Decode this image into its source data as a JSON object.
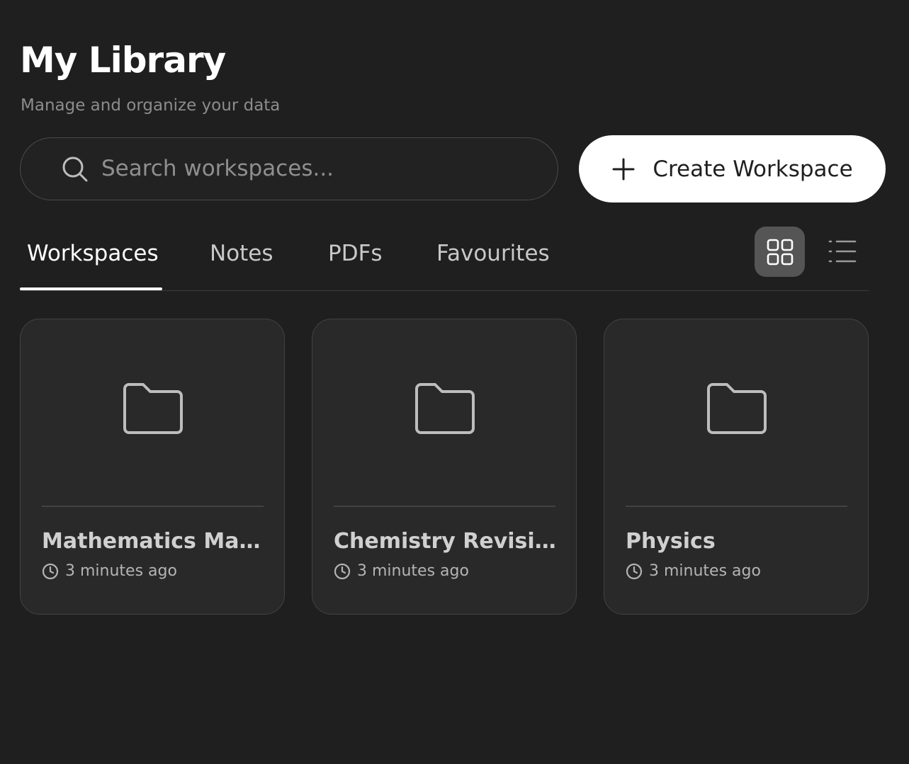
{
  "header": {
    "title": "My Library",
    "subtitle": "Manage and organize your data"
  },
  "search": {
    "placeholder": "Search workspaces...",
    "value": "",
    "icon": "search-icon"
  },
  "actions": {
    "create_label": "Create Workspace",
    "create_icon": "plus-icon"
  },
  "tabs": [
    {
      "label": "Workspaces",
      "active": true
    },
    {
      "label": "Notes",
      "active": false
    },
    {
      "label": "PDFs",
      "active": false
    },
    {
      "label": "Favourites",
      "active": false
    }
  ],
  "view_toggle": {
    "selected": "grid",
    "options": [
      "grid-icon",
      "list-icon"
    ]
  },
  "workspaces": [
    {
      "title": "Mathematics Mas…",
      "updated": "3 minutes ago",
      "icon": "folder-icon"
    },
    {
      "title": "Chemistry Revision",
      "updated": "3 minutes ago",
      "icon": "folder-icon"
    },
    {
      "title": "Physics",
      "updated": "3 minutes ago",
      "icon": "folder-icon"
    }
  ],
  "colors": {
    "background": "#1f1f1f",
    "card": "#292929",
    "border": "#424242",
    "primary_button": "#ffffff",
    "active_toggle": "#555555"
  }
}
